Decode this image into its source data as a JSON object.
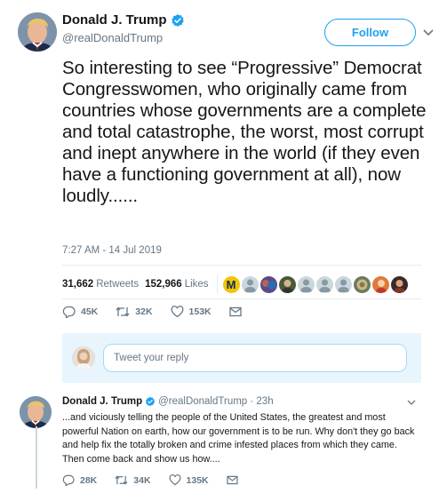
{
  "tweet": {
    "author": {
      "display_name": "Donald J. Trump",
      "handle": "@realDonaldTrump",
      "verified": true,
      "avatar_icon": "user-avatar-photo"
    },
    "follow_label": "Follow",
    "text": "So interesting to see “Progressive” Democrat Congresswomen, who originally came from countries whose governments are a complete and total catastrophe, the worst, most corrupt and inept anywhere in the world (if they even have a functioning government at all), now loudly......",
    "timestamp": "7:27 AM - 14 Jul 2019",
    "stats": {
      "retweets_count": "31,662",
      "retweets_label": "Retweets",
      "likes_count": "152,966",
      "likes_label": "Likes"
    },
    "actions": {
      "replies": "45K",
      "retweets": "32K",
      "likes": "153K"
    }
  },
  "reply_composer": {
    "placeholder": "Tweet your reply"
  },
  "reply_tweet": {
    "display_name": "Donald J. Trump",
    "handle_time": "@realDonaldTrump · 23h",
    "text": "...and viciously telling the people of the United States, the greatest and most powerful Nation on earth, how our government is to be run. Why don't they go back and help fix the totally broken and crime infested places from which they came. Then come back and show us how....",
    "actions": {
      "replies": "28K",
      "retweets": "34K",
      "likes": "135K"
    }
  },
  "colors": {
    "accent": "#1da1f2",
    "secondary_text": "#657786",
    "divider": "#e6ecf0",
    "composer_bg": "#e8f5fd"
  }
}
